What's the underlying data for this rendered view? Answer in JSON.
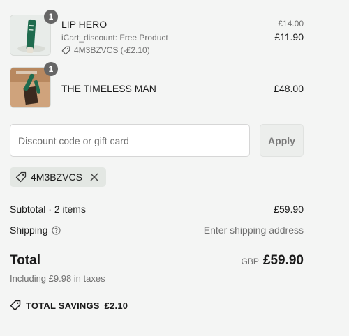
{
  "items": [
    {
      "name": "LIP HERO",
      "quantity": "1",
      "discount_note": "iCart_discount: Free Product",
      "discount_code": "4M3BZVCS (-£2.10)",
      "original_price": "£14.00",
      "price": "£11.90",
      "icon": "tag-icon"
    },
    {
      "name": "THE TIMELESS MAN",
      "quantity": "1",
      "price": "£48.00"
    }
  ],
  "discount": {
    "placeholder": "Discount code or gift card",
    "value": "",
    "apply_label": "Apply",
    "applied_code": "4M3BZVCS"
  },
  "summary": {
    "subtotal_label": "Subtotal · 2 items",
    "subtotal_value": "£59.90",
    "shipping_label": "Shipping",
    "shipping_value": "Enter shipping address",
    "total_label": "Total",
    "currency": "GBP",
    "total_value": "£59.90",
    "taxes_note": "Including £9.98 in taxes",
    "savings_label": "TOTAL SAVINGS",
    "savings_value": "£2.10"
  },
  "colors": {
    "background": "#f4f5f4",
    "badge": "#666666",
    "chip": "#e3e7e3",
    "product_green": "#1f6b4e"
  }
}
